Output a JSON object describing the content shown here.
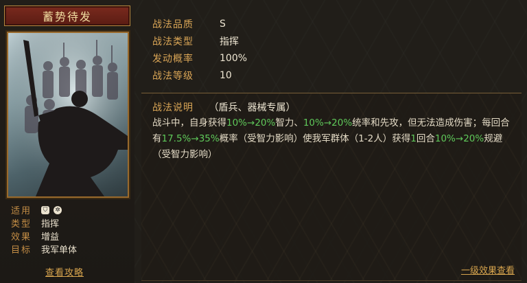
{
  "skill_name": "蓄势待发",
  "properties": [
    {
      "label": "适用",
      "icons": [
        "shield-icon",
        "gear-icon"
      ]
    },
    {
      "label": "类型",
      "value": "指挥"
    },
    {
      "label": "效果",
      "value": "增益"
    },
    {
      "label": "目标",
      "value": "我军单体"
    }
  ],
  "left_link": "查看攻略",
  "stats": [
    {
      "label": "战法品质",
      "value": "S"
    },
    {
      "label": "战法类型",
      "value": "指挥"
    },
    {
      "label": "发动概率",
      "value": "100%"
    },
    {
      "label": "战法等级",
      "value": "10"
    }
  ],
  "description": {
    "heading": "战法说明",
    "subheading": "（盾兵、器械专属）",
    "seg": [
      "战斗中，自身获得",
      "10%→20%",
      "智力、",
      "10%→20%",
      "统率和先攻，但无法造成伤害；每回合有",
      "17.5%→35%",
      "概率（受智力影响）使我军群体（1-2人）获得",
      "1",
      "回合",
      "10%→20%",
      "规避（受智力影响）"
    ]
  },
  "right_link": "一级效果查看",
  "colors": {
    "highlight": "#5fc95a",
    "label": "#d9a556",
    "banner": "#7a2a1e"
  }
}
